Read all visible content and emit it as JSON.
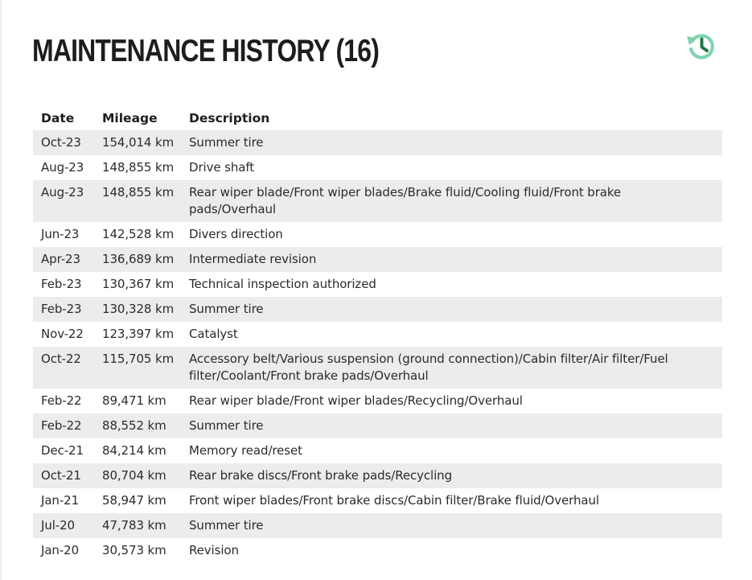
{
  "header": {
    "title": "MAINTENANCE HISTORY (16)",
    "history_icon": "history-icon",
    "accent_color": "#1a7a4c",
    "icon_light_color": "#7fd3b1"
  },
  "table": {
    "columns": [
      "Date",
      "Mileage",
      "Description"
    ],
    "rows": [
      {
        "date": "Oct-23",
        "mileage": "154,014 km",
        "description": "Summer tire"
      },
      {
        "date": "Aug-23",
        "mileage": "148,855 km",
        "description": "Drive shaft"
      },
      {
        "date": "Aug-23",
        "mileage": "148,855 km",
        "description": "Rear wiper blade/Front wiper blades/Brake fluid/Cooling fluid/Front brake pads/Overhaul"
      },
      {
        "date": "Jun-23",
        "mileage": "142,528 km",
        "description": "Divers direction"
      },
      {
        "date": "Apr-23",
        "mileage": "136,689 km",
        "description": "Intermediate revision"
      },
      {
        "date": "Feb-23",
        "mileage": "130,367 km",
        "description": "Technical inspection authorized"
      },
      {
        "date": "Feb-23",
        "mileage": "130,328 km",
        "description": "Summer tire"
      },
      {
        "date": "Nov-22",
        "mileage": "123,397 km",
        "description": "Catalyst"
      },
      {
        "date": "Oct-22",
        "mileage": "115,705 km",
        "description": "Accessory belt/Various suspension (ground connection)/Cabin filter/Air filter/Fuel filter/Coolant/Front brake pads/Overhaul"
      },
      {
        "date": "Feb-22",
        "mileage": "89,471 km",
        "description": "Rear wiper blade/Front wiper blades/Recycling/Overhaul"
      },
      {
        "date": "Feb-22",
        "mileage": "88,552 km",
        "description": "Summer tire"
      },
      {
        "date": "Dec-21",
        "mileage": "84,214 km",
        "description": "Memory read/reset"
      },
      {
        "date": "Oct-21",
        "mileage": "80,704 km",
        "description": "Rear brake discs/Front brake pads/Recycling"
      },
      {
        "date": "Jan-21",
        "mileage": "58,947 km",
        "description": "Front wiper blades/Front brake discs/Cabin filter/Brake fluid/Overhaul"
      },
      {
        "date": "Jul-20",
        "mileage": "47,783 km",
        "description": "Summer tire"
      },
      {
        "date": "Jan-20",
        "mileage": "30,573 km",
        "description": "Revision"
      }
    ]
  }
}
